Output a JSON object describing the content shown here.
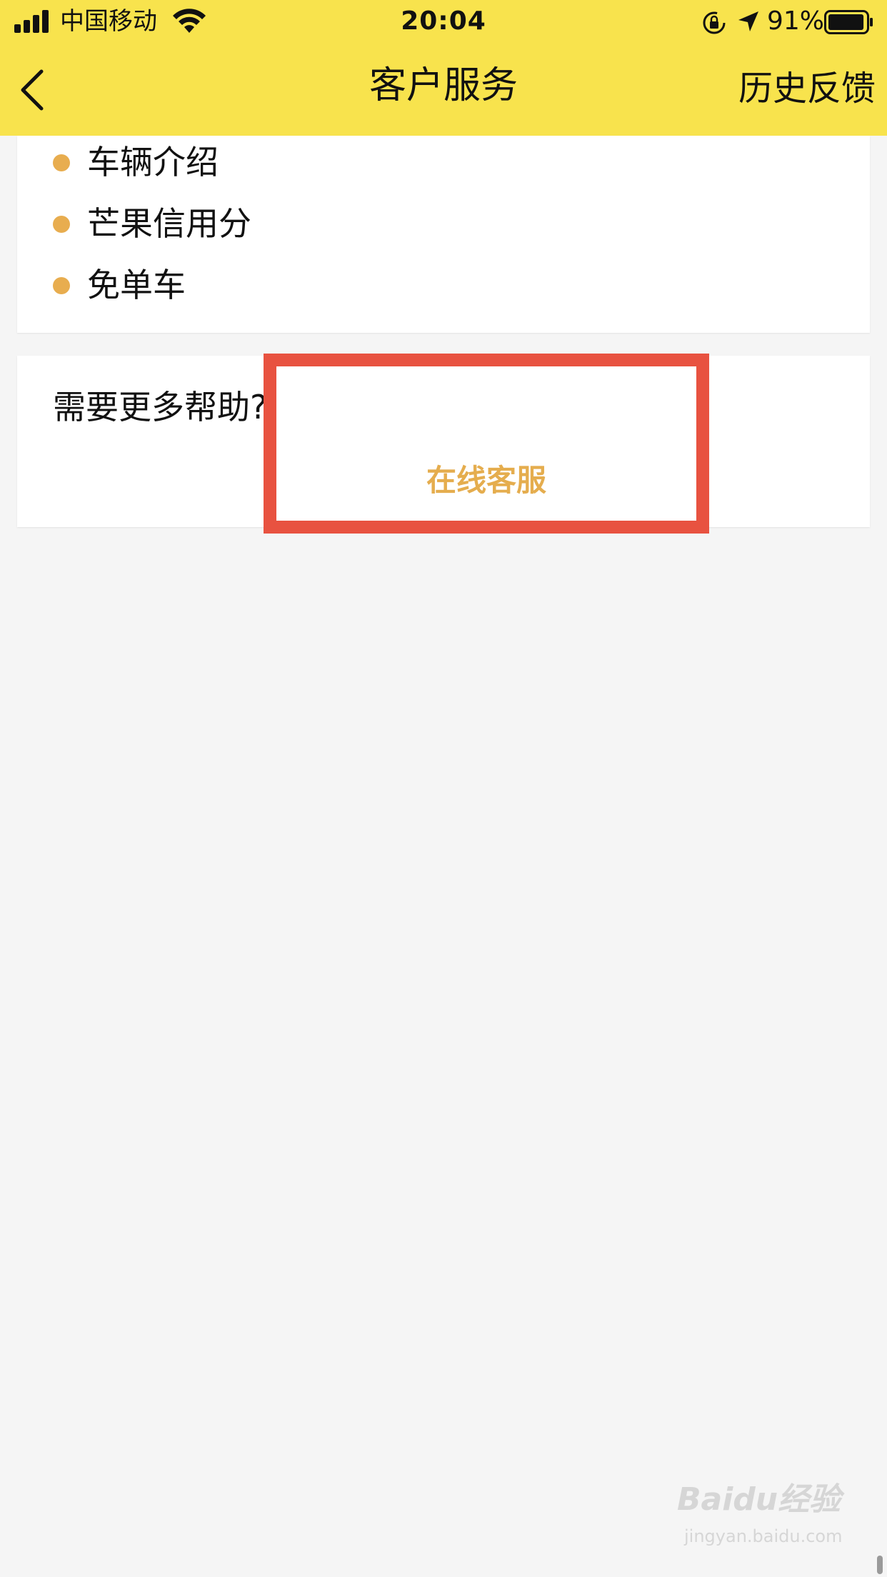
{
  "status_bar": {
    "carrier": "中国移动",
    "time": "20:04",
    "battery_percent": "91%",
    "battery_level": 0.91,
    "icons": [
      "signal-icon",
      "wifi-icon",
      "rotation-lock-icon",
      "location-arrow-icon",
      "battery-icon"
    ]
  },
  "nav": {
    "title": "客户服务",
    "history_label": "历史反馈",
    "back_icon": "chevron-left-icon"
  },
  "links": {
    "items": [
      {
        "label": "车辆介绍"
      },
      {
        "label": "芒果信用分"
      },
      {
        "label": "免单车"
      }
    ]
  },
  "help": {
    "title": "需要更多帮助?",
    "online_service_label": "在线客服"
  },
  "colors": {
    "header_bg": "#f8e34d",
    "bullet": "#e8ad4f",
    "accent_text": "#e5ad4e",
    "highlight_border": "#e85240",
    "page_bg": "#f5f5f5"
  },
  "watermark": {
    "text": "Baidu经验",
    "sub": "jingyan.baidu.com"
  }
}
